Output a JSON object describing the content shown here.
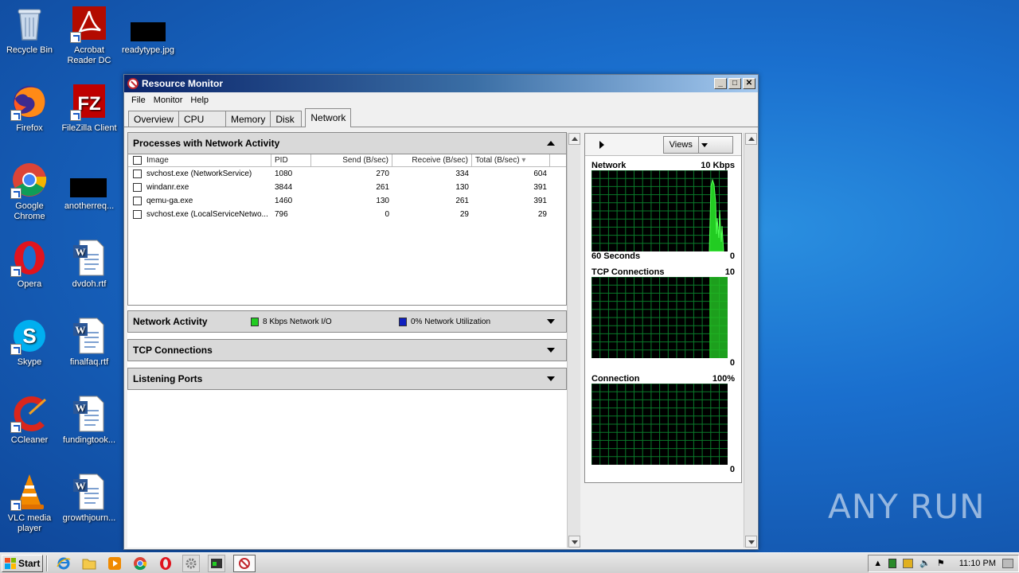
{
  "desktop": {
    "icons": [
      {
        "label": "Recycle Bin"
      },
      {
        "label": "Acrobat Reader DC"
      },
      {
        "label": "readytype.jpg"
      },
      {
        "label": "Firefox"
      },
      {
        "label": "FileZilla Client"
      },
      {
        "label": "Google Chrome"
      },
      {
        "label": "anotherreq..."
      },
      {
        "label": "Opera"
      },
      {
        "label": "dvdoh.rtf"
      },
      {
        "label": "Skype"
      },
      {
        "label": "finalfaq.rtf"
      },
      {
        "label": "CCleaner"
      },
      {
        "label": "fundingtook..."
      },
      {
        "label": "VLC media player"
      },
      {
        "label": "growthjourn..."
      }
    ],
    "watermark": "ANY RUN"
  },
  "window": {
    "title": "Resource Monitor",
    "menu": [
      "File",
      "Monitor",
      "Help"
    ],
    "tabs": [
      "Overview",
      "CPU",
      "Memory",
      "Disk",
      "Network"
    ],
    "active_tab": "Network",
    "processes": {
      "title": "Processes with Network Activity",
      "columns": [
        "Image",
        "PID",
        "Send (B/sec)",
        "Receive (B/sec)",
        "Total (B/sec)"
      ],
      "rows": [
        {
          "image": "svchost.exe (NetworkService)",
          "pid": "1080",
          "send": "270",
          "receive": "334",
          "total": "604"
        },
        {
          "image": "windanr.exe",
          "pid": "3844",
          "send": "261",
          "receive": "130",
          "total": "391"
        },
        {
          "image": "qemu-ga.exe",
          "pid": "1460",
          "send": "130",
          "receive": "261",
          "total": "391"
        },
        {
          "image": "svchost.exe (LocalServiceNetwo...",
          "pid": "796",
          "send": "0",
          "receive": "29",
          "total": "29"
        }
      ]
    },
    "network_activity": {
      "title": "Network Activity",
      "io_label": "8 Kbps Network I/O",
      "util_label": "0% Network Utilization",
      "io_color": "#22cc22",
      "util_color": "#1020c0"
    },
    "tcp_connections": {
      "title": "TCP Connections"
    },
    "listening_ports": {
      "title": "Listening Ports"
    },
    "right_pane": {
      "views_label": "Views",
      "graphs": [
        {
          "title": "Network",
          "max": "10 Kbps",
          "bottom_left": "60 Seconds",
          "bottom_right": "0"
        },
        {
          "title": "TCP Connections",
          "max": "10",
          "bottom_left": "",
          "bottom_right": "0"
        },
        {
          "title": "Connection",
          "max": "100%",
          "bottom_left": "",
          "bottom_right": "0"
        }
      ]
    }
  },
  "taskbar": {
    "start_label": "Start",
    "clock": "11:10 PM"
  }
}
